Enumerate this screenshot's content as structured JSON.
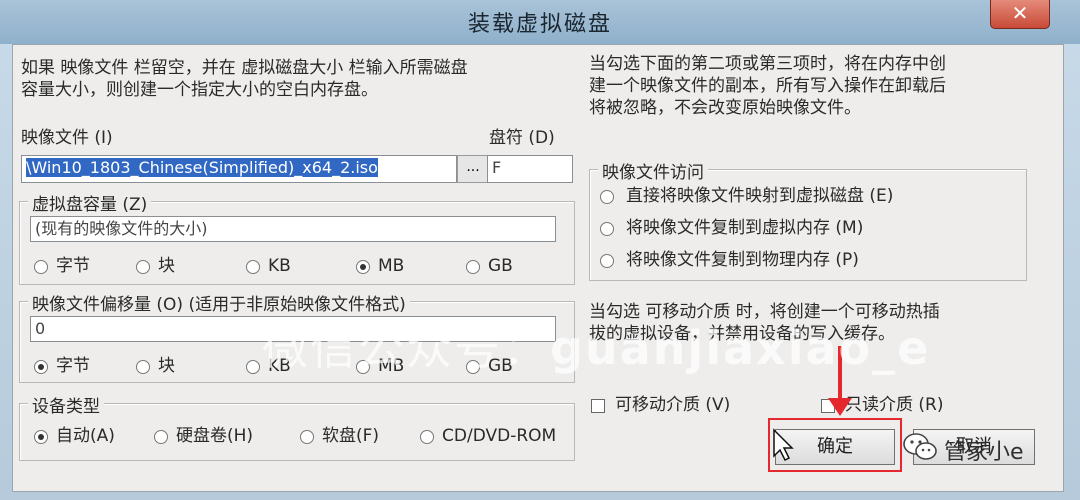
{
  "window": {
    "title": "装载虚拟磁盘",
    "close_glyph": "✕"
  },
  "instructions": {
    "left_line1": "如果 映像文件 栏留空，并在 虚拟磁盘大小 栏输入所需磁盘",
    "left_line2": "容量大小，则创建一个指定大小的空白内存盘。",
    "right_line1": "当勾选下面的第二项或第三项时，将在内存中创",
    "right_line2": "建一个映像文件的副本，所有写入操作在卸载后",
    "right_line3": "将被忽略，不会改变原始映像文件。"
  },
  "image_file": {
    "label": "映像文件 (I)",
    "value": "\\Win10_1803_Chinese(Simplified)_x64_2.iso",
    "browse": "..."
  },
  "drive": {
    "label": "盘符 (D)",
    "value": "F"
  },
  "capacity": {
    "legend": "虚拟盘容量 (Z)",
    "value": "(现有的映像文件的大小)",
    "units": [
      "字节",
      "块",
      "KB",
      "MB",
      "GB"
    ],
    "selected": "MB"
  },
  "offset": {
    "legend": "映像文件偏移量 (O) (适用于非原始映像文件格式)",
    "value": "0",
    "units": [
      "字节",
      "块",
      "KB",
      "MB",
      "GB"
    ],
    "selected": "字节"
  },
  "device": {
    "legend": "设备类型",
    "options": [
      "自动(A)",
      "硬盘卷(H)",
      "软盘(F)",
      "CD/DVD-ROM"
    ],
    "selected": "自动(A)"
  },
  "access": {
    "legend": "映像文件访问",
    "options": [
      "直接将映像文件映射到虚拟磁盘 (E)",
      "将映像文件复制到虚拟内存 (M)",
      "将映像文件复制到物理内存 (P)"
    ]
  },
  "removable_note": {
    "line1": "当勾选 可移动介质 时，将创建一个可移动热插",
    "line2": "拔的虚拟设备，并禁用设备的写入缓存。"
  },
  "options": {
    "removable": "可移动介质 (V)",
    "readonly": "只读介质 (R)"
  },
  "buttons": {
    "ok": "确定",
    "cancel": "取消"
  },
  "overlay": {
    "watermark_cn": "微信公众号：",
    "watermark_id": "guanjiaxiao_e",
    "badge": "管家小e"
  },
  "colors": {
    "highlight": "#e5282e",
    "selection": "#3168c4"
  }
}
